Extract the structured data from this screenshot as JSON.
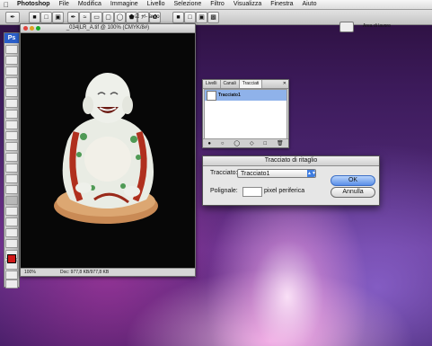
{
  "menubar": {
    "items": [
      "Photoshop",
      "File",
      "Modifica",
      "Immagine",
      "Livello",
      "Selezione",
      "Filtro",
      "Visualizza",
      "Finestra",
      "Aiuto"
    ]
  },
  "options_bar": {
    "auto_label": "+/- auto",
    "workspace_label": "Area di lavoro"
  },
  "toolbox": {
    "app_label": "Ps",
    "foreground_color": "#d01818"
  },
  "document": {
    "title": "_034|LR_A.tif @ 100% (CMYK/8#)",
    "zoom": "100%",
    "doc_info": "Doc: 977,8 KB/977,8 KB"
  },
  "paths_panel": {
    "tabs": [
      "Livelli",
      "Canali",
      "Tracciati"
    ],
    "active_tab": "Tracciati",
    "paths": [
      "Tracciato1"
    ]
  },
  "clipping_dialog": {
    "title": "Tracciato di ritaglio",
    "path_label": "Tracciato:",
    "path_value": "Tracciato1",
    "flatness_label": "Polignale:",
    "flatness_value": "",
    "flatness_unit": "pixel periferica",
    "ok_label": "OK",
    "cancel_label": "Annulla"
  }
}
